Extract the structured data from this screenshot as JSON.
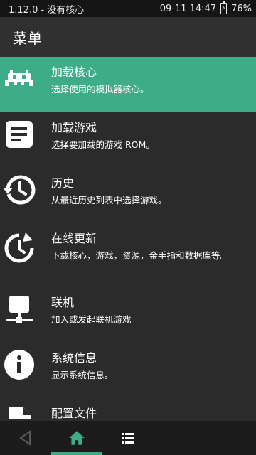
{
  "status_bar": {
    "left_text": "1.12.0 - 没有核心",
    "time": "09-11 14:47",
    "battery": "76%"
  },
  "app_bar": {
    "title": "菜单"
  },
  "menu": {
    "items": [
      {
        "title": "加载核心",
        "subtitle": "选择使用的模拟器核心。",
        "icon": "core-icon"
      },
      {
        "title": "加载游戏",
        "subtitle": "选择要加载的游戏 ROM。",
        "icon": "document-icon"
      },
      {
        "title": "历史",
        "subtitle": "从最近历史列表中选择游戏。",
        "icon": "history-icon"
      },
      {
        "title": "在线更新",
        "subtitle": "下载核心，游戏，资源，金手指和数据库等。",
        "icon": "update-icon"
      },
      {
        "title": "联机",
        "subtitle": "加入或发起联机游戏。",
        "icon": "netplay-icon"
      },
      {
        "title": "系统信息",
        "subtitle": "显示系统信息。",
        "icon": "info-icon"
      },
      {
        "title": "配置文件",
        "subtitle": "",
        "icon": "config-file-icon"
      }
    ]
  },
  "bottom_nav": {
    "items": [
      "back-icon",
      "home-icon",
      "list-icon"
    ]
  },
  "colors": {
    "accent": "#3eac87",
    "background": "#2b2b2b",
    "app_bar": "#303030",
    "status_bar": "#151515",
    "nav_bar": "#1c1c1c"
  }
}
